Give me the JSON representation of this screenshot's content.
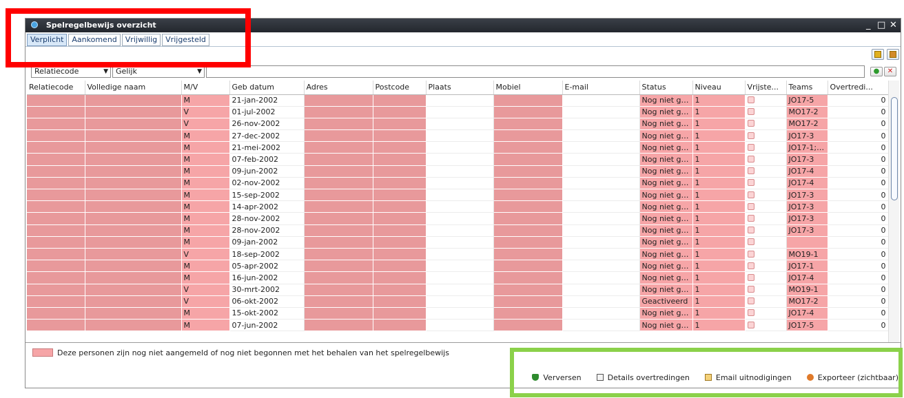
{
  "window": {
    "title": "Spelregelbewijs overzicht",
    "controls": [
      "_",
      "□",
      "✕"
    ]
  },
  "tabs": [
    "Verplicht",
    "Aankomend",
    "Vrijwillig",
    "Vrijgesteld"
  ],
  "filter": {
    "field": "Relatiecode",
    "operator": "Gelijk",
    "value": ""
  },
  "columns": [
    "Relatiecode",
    "Volledige naam",
    "M/V",
    "Geb datum",
    "Adres",
    "Postcode",
    "Plaats",
    "Mobiel",
    "E-mail",
    "Status",
    "Niveau",
    "Vrijste...",
    "Teams",
    "Overtredi..."
  ],
  "rows": [
    [
      "M",
      "21-jan-2002",
      "Nog niet gea...",
      "1",
      "JO17-5",
      "0"
    ],
    [
      "V",
      "01-jul-2002",
      "Nog niet gea...",
      "1",
      "MO17-2",
      "0"
    ],
    [
      "V",
      "26-nov-2002",
      "Nog niet gea...",
      "1",
      "MO17-2",
      "0"
    ],
    [
      "M",
      "27-dec-2002",
      "Nog niet gea...",
      "1",
      "JO17-3",
      "0"
    ],
    [
      "M",
      "21-mei-2002",
      "Nog niet gea...",
      "1",
      "JO17-1;JO...",
      "0"
    ],
    [
      "M",
      "07-feb-2002",
      "Nog niet gea...",
      "1",
      "JO17-3",
      "0"
    ],
    [
      "M",
      "09-jun-2002",
      "Nog niet gea...",
      "1",
      "JO17-4",
      "0"
    ],
    [
      "M",
      "02-nov-2002",
      "Nog niet gea...",
      "1",
      "JO17-4",
      "0"
    ],
    [
      "M",
      "15-sep-2002",
      "Nog niet gea...",
      "1",
      "JO17-3",
      "0"
    ],
    [
      "M",
      "14-apr-2002",
      "Nog niet gea...",
      "1",
      "JO17-3",
      "0"
    ],
    [
      "M",
      "28-nov-2002",
      "Nog niet gea...",
      "1",
      "JO17-3",
      "0"
    ],
    [
      "M",
      "28-nov-2002",
      "Nog niet gea...",
      "1",
      "JO17-3",
      "0"
    ],
    [
      "M",
      "09-jan-2002",
      "Nog niet gea...",
      "1",
      "",
      "0"
    ],
    [
      "V",
      "18-sep-2002",
      "Nog niet gea...",
      "1",
      "MO19-1",
      "0"
    ],
    [
      "M",
      "05-apr-2002",
      "Nog niet gea...",
      "1",
      "JO17-1",
      "0"
    ],
    [
      "M",
      "16-jun-2002",
      "Nog niet gea...",
      "1",
      "JO17-4",
      "0"
    ],
    [
      "V",
      "30-mrt-2002",
      "Nog niet gea...",
      "1",
      "MO19-1",
      "0"
    ],
    [
      "V",
      "06-okt-2002",
      "Geactiveerd",
      "1",
      "MO17-2",
      "0"
    ],
    [
      "M",
      "15-okt-2002",
      "Nog niet gea...",
      "1",
      "JO17-4",
      "0"
    ],
    [
      "M",
      "07-jun-2002",
      "Nog niet gea...",
      "1",
      "JO17-5",
      "0"
    ]
  ],
  "legend": "Deze personen zijn nog niet aangemeld of nog niet begonnen met het behalen van het spelregelbewijs",
  "actions": {
    "refresh": "Verversen",
    "details": "Details overtredingen",
    "email": "Email uitnodigingen",
    "export": "Exporteer (zichtbaar)"
  },
  "colors": {
    "highlight_row": "#f6a5a7",
    "annotation_red": "#ff0000",
    "annotation_green": "#8bd14a"
  }
}
